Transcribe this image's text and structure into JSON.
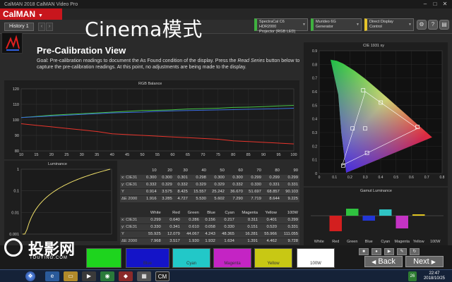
{
  "window": {
    "title": "CalMAN 2018 CalMAN Video Pro",
    "minimize": "–",
    "maximize": "□",
    "close": "✕"
  },
  "brand": {
    "name": "CalMAN",
    "caret": "▼"
  },
  "tabs": {
    "history": "History 1"
  },
  "overlay": {
    "title": "Cinema模式"
  },
  "devices": [
    {
      "line1": "SpectraCal C6 HDR2000",
      "line2": "Projector (RGB LED)"
    },
    {
      "line1": "Murideo 6G Generator",
      "line2": ""
    },
    {
      "line1": "Direct Display Control",
      "line2": ""
    }
  ],
  "header": {
    "title": "Pre-Calibration View",
    "goal_a": "Goal: Pre-calibration readings to document the As Found condition of the display. Press the ",
    "goal_em": "Read Series",
    "goal_b": " button below to capture the pre-calibration readings. At this point, no adjustments are being made to the display."
  },
  "rgb_balance": {
    "title": "RGB Balance",
    "ylim": [
      80,
      120
    ],
    "yticks": [
      "120",
      "110",
      "100",
      "90",
      "80"
    ],
    "xticks": [
      "10",
      "15",
      "20",
      "25",
      "30",
      "35",
      "40",
      "45",
      "50",
      "55",
      "60",
      "65",
      "70",
      "75",
      "80",
      "85",
      "90",
      "95",
      "100"
    ],
    "x": [
      10,
      15,
      20,
      25,
      30,
      35,
      40,
      45,
      50,
      55,
      60,
      65,
      70,
      75,
      80,
      85,
      90,
      95,
      100
    ],
    "series": [
      {
        "color": "#e8352c",
        "values": [
          97.5,
          96.5,
          95.5,
          94.5,
          93.5,
          92.5,
          91,
          90.5,
          90,
          89.5,
          89,
          88.5,
          88,
          87.5,
          86.5,
          86,
          85.5,
          85,
          84.5
        ]
      },
      {
        "color": "#46c346",
        "values": [
          101.5,
          102.2,
          103,
          103.5,
          104,
          104.5,
          105,
          105.5,
          106,
          106.2,
          106.5,
          107,
          107.2,
          107.5,
          108,
          108.2,
          108.5,
          109,
          109.3
        ]
      },
      {
        "color": "#3b6fe0",
        "values": [
          101.5,
          102,
          102.5,
          103,
          103.5,
          104,
          104.5,
          104.8,
          105,
          105.5,
          105.8,
          106,
          106.2,
          106.4,
          106.6,
          106.8,
          107,
          107.2,
          107.5
        ]
      }
    ]
  },
  "luminance": {
    "title": "Luminance",
    "yticks": [
      "1",
      "0.1",
      "0.01",
      "0.001"
    ],
    "curve_color": "#f0e06a"
  },
  "cie": {
    "title": "CIE 1931 xy",
    "xticks": [
      "0",
      "0.1",
      "0.2",
      "0.3",
      "0.4",
      "0.5",
      "0.6",
      "0.7",
      "0.8"
    ],
    "yticks": [
      "0.9",
      "0.8",
      "0.7",
      "0.6",
      "0.5",
      "0.4",
      "0.3",
      "0.2",
      "0.1",
      "0"
    ]
  },
  "gray_table": {
    "columns": [
      "",
      "10",
      "20",
      "30",
      "40",
      "50",
      "60",
      "70",
      "80",
      "90"
    ],
    "rows": [
      [
        "x: CIE31",
        "0.300",
        "0.300",
        "0.301",
        "0.298",
        "0.300",
        "0.300",
        "0.299",
        "0.299",
        "0.299"
      ],
      [
        "y: CIE31",
        "0.332",
        "0.329",
        "0.332",
        "0.329",
        "0.329",
        "0.332",
        "0.330",
        "0.331",
        "0.331"
      ],
      [
        "Y",
        "0.914",
        "3.575",
        "8.425",
        "15.557",
        "25.242",
        "36.670",
        "51.697",
        "68.857",
        "90.103"
      ],
      [
        "ΔE 2000",
        "1.916",
        "3.285",
        "4.727",
        "5.530",
        "5.602",
        "7.290",
        "7.719",
        "8.644",
        "9.225"
      ]
    ]
  },
  "color_table": {
    "columns": [
      "",
      "White",
      "Red",
      "Green",
      "Blue",
      "Cyan",
      "Magenta",
      "Yellow",
      "100W"
    ],
    "rows": [
      [
        "x: CIE31",
        "0.299",
        "0.640",
        "0.286",
        "0.156",
        "0.217",
        "0.311",
        "0.401",
        "0.299"
      ],
      [
        "y: CIE31",
        "0.330",
        "0.341",
        "0.610",
        "0.058",
        "0.330",
        "0.151",
        "0.520",
        "0.331"
      ],
      [
        "Y",
        "55.925",
        "12.079",
        "44.067",
        "4.243",
        "48.365",
        "16.281",
        "55.966",
        "111.055"
      ],
      [
        "ΔE 2000",
        "7.968",
        "3.517",
        "1.930",
        "1.932",
        "1.634",
        "1.391",
        "4.462",
        "9.728"
      ]
    ]
  },
  "gamut": {
    "title": "Gamut Luminance",
    "labels": [
      "White",
      "Red",
      "Green",
      "Blue",
      "Cyan",
      "Magenta",
      "Yellow",
      "100W"
    ],
    "values": [
      0,
      -22,
      10,
      -7,
      9,
      -18,
      2,
      0
    ],
    "colors": [
      "#cccccc",
      "#d31f1f",
      "#2fc23f",
      "#2236d6",
      "#2fc3c3",
      "#c433c4",
      "#e0c420",
      "#cccccc"
    ]
  },
  "swatches": [
    {
      "label": "",
      "color": "#1ed41e"
    },
    {
      "label": "Blue",
      "color": "#1414c8"
    },
    {
      "label": "Cyan",
      "color": "#22c8c8"
    },
    {
      "label": "Magenta",
      "color": "#c424c4"
    },
    {
      "label": "Yellow",
      "color": "#c8c814"
    },
    {
      "label": "100W",
      "color": "#ffffff"
    }
  ],
  "nav": {
    "back": "Back",
    "next": "Next",
    "back_arrow": "◀",
    "next_arrow": "▶"
  },
  "watermark": {
    "text": "投影网",
    "sub": "TOUYING.COM"
  },
  "taskbar": {
    "time": "22:47",
    "date": "2018/10/25",
    "cm": "CM",
    "badge": "26"
  }
}
